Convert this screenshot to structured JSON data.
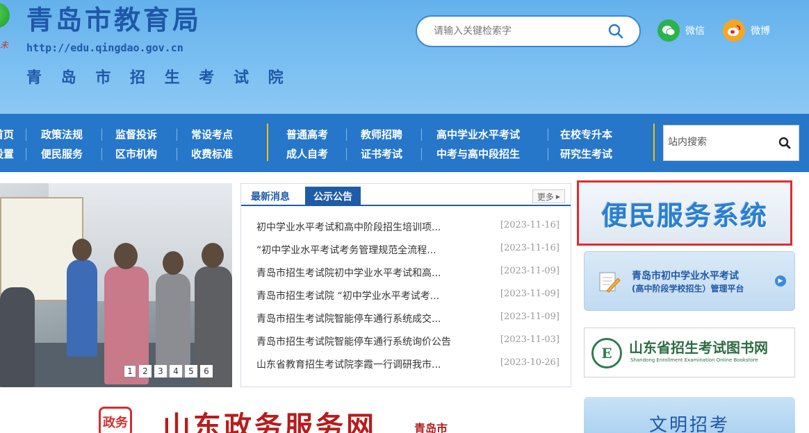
{
  "header": {
    "title": "青岛市教育局",
    "url": "http://edu.qingdao.gov.cn",
    "subtitle": "青 岛 市 招 生 考 试 院",
    "search_placeholder": "请输入关键检索字",
    "wechat_label": "微信",
    "weibo_label": "微博"
  },
  "nav": {
    "row1_left": [
      "首页",
      "政策法规",
      "监督投诉",
      "常设考点"
    ],
    "row2_left": [
      "设置",
      "便民服务",
      "区市机构",
      "收费标准"
    ],
    "row1_right": [
      "普通高考",
      "教师招聘",
      "高中学业水平考试",
      "在校专升本"
    ],
    "row2_right": [
      "成人自考",
      "证书考试",
      "中考与高中段招生",
      "研究生考试"
    ],
    "site_search_placeholder": "站内搜索"
  },
  "slider": {
    "numbers": [
      "1",
      "2",
      "3",
      "4",
      "5",
      "6"
    ]
  },
  "news": {
    "tab_latest": "最新消息",
    "tab_notice": "公示公告",
    "more": "更多",
    "items": [
      {
        "title": "初中学业水平考试和高中阶段招生培训项...",
        "date": "[2023-11-16]"
      },
      {
        "title": "“初中学业水平考试考务管理规范全流程...",
        "date": "[2023-11-16]"
      },
      {
        "title": "青岛市招生考试院初中学业水平考试和高...",
        "date": "[2023-11-09]"
      },
      {
        "title": "青岛市招生考试院 “初中学业水平考试考...",
        "date": "[2023-11-09]"
      },
      {
        "title": "青岛市招生考试院智能停车通行系统成交...",
        "date": "[2023-11-09]"
      },
      {
        "title": "青岛市招生考试院智能停车通行系统询价公告",
        "date": "[2023-11-03]"
      },
      {
        "title": "山东省教育招生考试院李霞一行调研我市...",
        "date": "[2023-10-26]"
      }
    ]
  },
  "right": {
    "service_banner": "便民服务系统",
    "exam_platform_line1": "青岛市初中学业水平考试",
    "exam_platform_line2": "(高中阶段学校招生）管理平台",
    "bookstore_cn": "山东省招生考试图书网",
    "bookstore_en": "Shandong Enrollment Examination Online Bookstore",
    "bookstore_logo": "E",
    "civil_exam": "文明招考"
  },
  "bottom": {
    "gov_logo": "政务",
    "gov_title": "山东政务服务网",
    "gov_city": "青岛市"
  },
  "colors": {
    "header_bg": "#6fb8ef",
    "nav_bg": "#2677c9",
    "brand_blue": "#1f58a8",
    "highlight_red": "#e02b2b"
  }
}
